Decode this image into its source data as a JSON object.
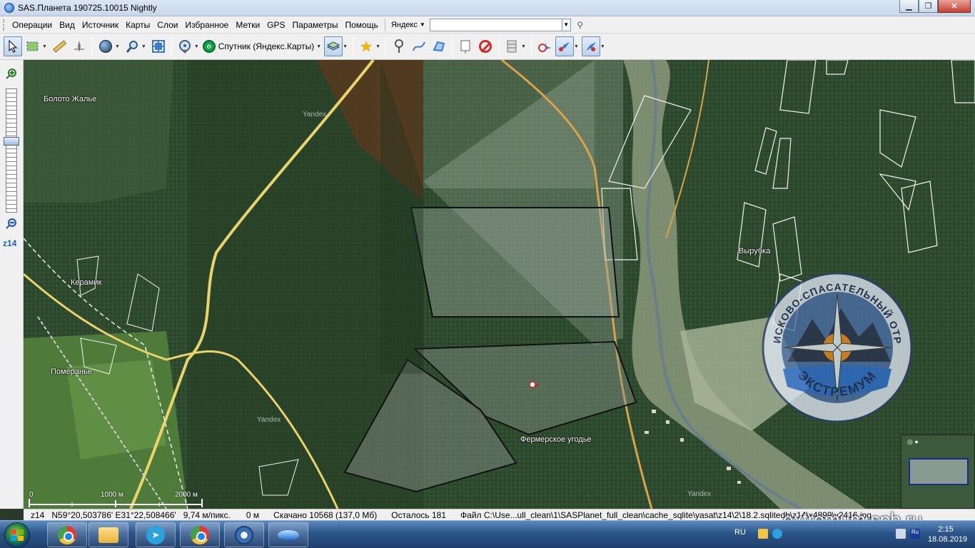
{
  "window": {
    "title": "SAS.Планета 190725.10015 Nightly",
    "controls": {
      "minimize": "▁",
      "maximize": "❐",
      "close": "✕"
    }
  },
  "menu": {
    "items": [
      "Операции",
      "Вид",
      "Источник",
      "Карты",
      "Слои",
      "Избранное",
      "Метки",
      "GPS",
      "Параметры",
      "Помощь"
    ],
    "search_engine": "Яндекс",
    "search_value": ""
  },
  "toolbar": {
    "map_type_label": "Спутник (Яндекс.Карты)"
  },
  "zoom": {
    "level_label": "z14",
    "level_fraction": 0.42
  },
  "map": {
    "labels": {
      "boloto": "Болото Жалье",
      "keramik": "Керамик",
      "pomeranye": "Померанье",
      "vyrubka": "Вырубка",
      "fermer": "Фермерское угодье"
    },
    "yandex_watermark": "Yandex",
    "scale": {
      "zero": "0",
      "mid": "1000 м",
      "end": "2000 м"
    }
  },
  "status": {
    "zoom": "z14",
    "coords": "N59°20,503786' E31°22,508466'",
    "resolution": "9,74 м/пикс.",
    "distance": "0 м",
    "downloaded": "Скачано 10568 (137,0 Мб)",
    "remaining": "Осталось 181",
    "file": "Файл C:\\Use...ull_clean\\1\\SASPlanet_full_clean\\cache_sqlite\\yasat\\z14\\2\\18.2.sqlitedb\\z14\\x4899\\y2416.jpg"
  },
  "watermark": {
    "site": "extremum.spb.ru",
    "emblem_top": "ПОИСКОВО-СПАСАТЕЛЬНЫЙ ОТРЯД",
    "emblem_bottom": "ЭКСТРЕМУМ"
  },
  "taskbar": {
    "lang": "RU",
    "time": "2:15",
    "date": "18.08.2019"
  }
}
